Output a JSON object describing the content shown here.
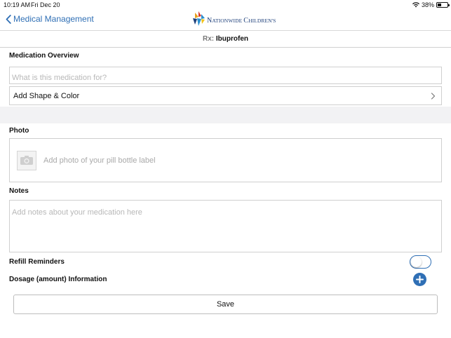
{
  "status_bar": {
    "time": "10:19 AM",
    "date": "Fri Dec 20",
    "battery": "38%"
  },
  "nav": {
    "back_label": "Medical Management",
    "logo_text_first": "N",
    "logo_text_rest": "ATIONWIDE ",
    "logo_text_c": "C",
    "logo_text_end": "HILDREN'S"
  },
  "rx": {
    "prefix": "Rx:",
    "name": "Ibuprofen"
  },
  "overview": {
    "title": "Medication Overview",
    "purpose_placeholder": "What is this medication for?",
    "shape_color_label": "Add Shape & Color"
  },
  "photo": {
    "title": "Photo",
    "prompt": "Add photo of your pill bottle label"
  },
  "notes": {
    "title": "Notes",
    "placeholder": "Add notes about your medication here"
  },
  "refill": {
    "label": "Refill Reminders",
    "enabled": false
  },
  "dosage": {
    "label": "Dosage (amount) Information"
  },
  "actions": {
    "save_label": "Save"
  },
  "colors": {
    "accent": "#2f6fb5",
    "border": "#cfcfcf",
    "band": "#f2f2f4"
  }
}
